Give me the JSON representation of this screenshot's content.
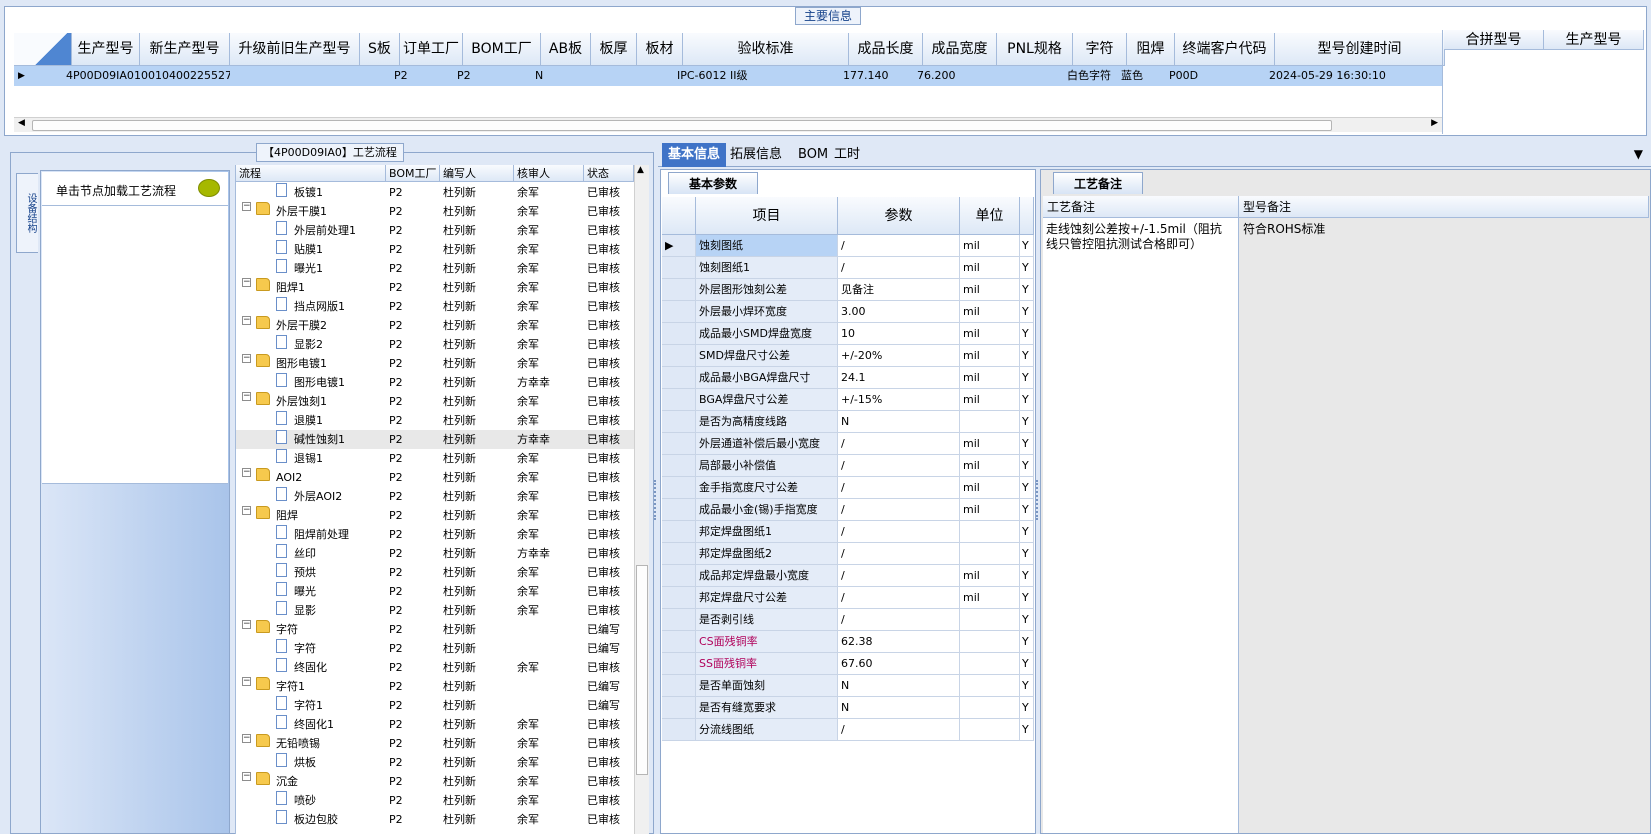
{
  "main": {
    "title": "主要信息",
    "columns": [
      "生产型号",
      "新生产型号",
      "升级前旧生产型号",
      "S板",
      "订单工厂",
      "BOM工厂",
      "AB板",
      "板厚",
      "板材",
      "验收标准",
      "成品长度",
      "成品宽度",
      "PNL规格",
      "字符",
      "阻焊",
      "终端客户代码",
      "型号创建时间"
    ],
    "row": [
      "4P00D09IA0",
      "10010400225527",
      "",
      "",
      "P2",
      "P2",
      "N",
      "",
      "",
      "IPC-6012 II级",
      "177.140",
      "76.200",
      "",
      "白色字符",
      "蓝色",
      "P00D",
      "2024-05-29 16:30:10"
    ],
    "side_columns": [
      "合拼型号",
      "生产型号"
    ]
  },
  "flow": {
    "title": "【4P00D09IA0】工艺流程",
    "side_tab": "设备结构",
    "hint": "单击节点加载工艺流程",
    "columns": [
      "流程",
      "BOM工厂",
      "编写人",
      "核审人",
      "状态"
    ],
    "rows": [
      {
        "name": "板镀1",
        "level": 2,
        "type": "doc",
        "bom": "P2",
        "writer": "杜列新",
        "reviewer": "余军",
        "status": "已审核"
      },
      {
        "name": "外层干膜1",
        "level": 1,
        "type": "folder",
        "bom": "P2",
        "writer": "杜列新",
        "reviewer": "余军",
        "status": "已审核"
      },
      {
        "name": "外层前处理1",
        "level": 2,
        "type": "doc",
        "bom": "P2",
        "writer": "杜列新",
        "reviewer": "余军",
        "status": "已审核"
      },
      {
        "name": "贴膜1",
        "level": 2,
        "type": "doc",
        "bom": "P2",
        "writer": "杜列新",
        "reviewer": "余军",
        "status": "已审核"
      },
      {
        "name": "曝光1",
        "level": 2,
        "type": "doc",
        "bom": "P2",
        "writer": "杜列新",
        "reviewer": "余军",
        "status": "已审核"
      },
      {
        "name": "阻焊1",
        "level": 1,
        "type": "folder",
        "bom": "P2",
        "writer": "杜列新",
        "reviewer": "余军",
        "status": "已审核"
      },
      {
        "name": "挡点网版1",
        "level": 2,
        "type": "doc",
        "bom": "P2",
        "writer": "杜列新",
        "reviewer": "余军",
        "status": "已审核"
      },
      {
        "name": "外层干膜2",
        "level": 1,
        "type": "folder",
        "bom": "P2",
        "writer": "杜列新",
        "reviewer": "余军",
        "status": "已审核"
      },
      {
        "name": "显影2",
        "level": 2,
        "type": "doc",
        "bom": "P2",
        "writer": "杜列新",
        "reviewer": "余军",
        "status": "已审核"
      },
      {
        "name": "图形电镀1",
        "level": 1,
        "type": "folder",
        "bom": "P2",
        "writer": "杜列新",
        "reviewer": "余军",
        "status": "已审核"
      },
      {
        "name": "图形电镀1",
        "level": 2,
        "type": "doc",
        "bom": "P2",
        "writer": "杜列新",
        "reviewer": "方幸幸",
        "status": "已审核"
      },
      {
        "name": "外层蚀刻1",
        "level": 1,
        "type": "folder",
        "bom": "P2",
        "writer": "杜列新",
        "reviewer": "余军",
        "status": "已审核"
      },
      {
        "name": "退膜1",
        "level": 2,
        "type": "doc",
        "bom": "P2",
        "writer": "杜列新",
        "reviewer": "余军",
        "status": "已审核"
      },
      {
        "name": "碱性蚀刻1",
        "level": 2,
        "type": "doc",
        "bom": "P2",
        "writer": "杜列新",
        "reviewer": "方幸幸",
        "status": "已审核",
        "selected": true
      },
      {
        "name": "退锡1",
        "level": 2,
        "type": "doc",
        "bom": "P2",
        "writer": "杜列新",
        "reviewer": "余军",
        "status": "已审核"
      },
      {
        "name": "AOI2",
        "level": 1,
        "type": "folder",
        "bom": "P2",
        "writer": "杜列新",
        "reviewer": "余军",
        "status": "已审核"
      },
      {
        "name": "外层AOI2",
        "level": 2,
        "type": "doc",
        "bom": "P2",
        "writer": "杜列新",
        "reviewer": "余军",
        "status": "已审核"
      },
      {
        "name": "阻焊",
        "level": 1,
        "type": "folder",
        "bom": "P2",
        "writer": "杜列新",
        "reviewer": "余军",
        "status": "已审核"
      },
      {
        "name": "阻焊前处理",
        "level": 2,
        "type": "doc",
        "bom": "P2",
        "writer": "杜列新",
        "reviewer": "余军",
        "status": "已审核"
      },
      {
        "name": "丝印",
        "level": 2,
        "type": "doc",
        "bom": "P2",
        "writer": "杜列新",
        "reviewer": "方幸幸",
        "status": "已审核"
      },
      {
        "name": "预烘",
        "level": 2,
        "type": "doc",
        "bom": "P2",
        "writer": "杜列新",
        "reviewer": "余军",
        "status": "已审核"
      },
      {
        "name": "曝光",
        "level": 2,
        "type": "doc",
        "bom": "P2",
        "writer": "杜列新",
        "reviewer": "余军",
        "status": "已审核"
      },
      {
        "name": "显影",
        "level": 2,
        "type": "doc",
        "bom": "P2",
        "writer": "杜列新",
        "reviewer": "余军",
        "status": "已审核"
      },
      {
        "name": "字符",
        "level": 1,
        "type": "folder",
        "bom": "P2",
        "writer": "杜列新",
        "reviewer": "",
        "status": "已编写"
      },
      {
        "name": "字符",
        "level": 2,
        "type": "doc",
        "bom": "P2",
        "writer": "杜列新",
        "reviewer": "",
        "status": "已编写"
      },
      {
        "name": "终固化",
        "level": 2,
        "type": "doc",
        "bom": "P2",
        "writer": "杜列新",
        "reviewer": "余军",
        "status": "已审核"
      },
      {
        "name": "字符1",
        "level": 1,
        "type": "folder",
        "bom": "P2",
        "writer": "杜列新",
        "reviewer": "",
        "status": "已编写"
      },
      {
        "name": "字符1",
        "level": 2,
        "type": "doc",
        "bom": "P2",
        "writer": "杜列新",
        "reviewer": "",
        "status": "已编写"
      },
      {
        "name": "终固化1",
        "level": 2,
        "type": "doc",
        "bom": "P2",
        "writer": "杜列新",
        "reviewer": "余军",
        "status": "已审核"
      },
      {
        "name": "无铅喷锡",
        "level": 1,
        "type": "folder",
        "bom": "P2",
        "writer": "杜列新",
        "reviewer": "余军",
        "status": "已审核"
      },
      {
        "name": "烘板",
        "level": 2,
        "type": "doc",
        "bom": "P2",
        "writer": "杜列新",
        "reviewer": "余军",
        "status": "已审核"
      },
      {
        "name": "沉金",
        "level": 1,
        "type": "folder",
        "bom": "P2",
        "writer": "杜列新",
        "reviewer": "余军",
        "status": "已审核"
      },
      {
        "name": "喷砂",
        "level": 2,
        "type": "doc",
        "bom": "P2",
        "writer": "杜列新",
        "reviewer": "余军",
        "status": "已审核"
      },
      {
        "name": "板边包胶",
        "level": 2,
        "type": "doc",
        "bom": "P2",
        "writer": "杜列新",
        "reviewer": "余军",
        "status": "已审核"
      }
    ]
  },
  "tabs": [
    "基本信息",
    "拓展信息",
    "BOM",
    "工时"
  ],
  "basic": {
    "subtab": "基本参数",
    "columns": [
      "项目",
      "参数",
      "单位"
    ],
    "rows": [
      {
        "item": "蚀刻图纸",
        "value": "/",
        "unit": "mil",
        "flag": "Y"
      },
      {
        "item": "蚀刻图纸1",
        "value": "/",
        "unit": "mil",
        "flag": "Y"
      },
      {
        "item": "外层图形蚀刻公差",
        "value": "见备注",
        "unit": "mil",
        "flag": "Y"
      },
      {
        "item": "外层最小焊环宽度",
        "value": "3.00",
        "unit": "mil",
        "flag": "Y"
      },
      {
        "item": "成品最小SMD焊盘宽度",
        "value": "10",
        "unit": "mil",
        "flag": "Y"
      },
      {
        "item": "SMD焊盘尺寸公差",
        "value": "+/-20%",
        "unit": "mil",
        "flag": "Y"
      },
      {
        "item": "成品最小BGA焊盘尺寸",
        "value": "24.1",
        "unit": "mil",
        "flag": "Y"
      },
      {
        "item": "BGA焊盘尺寸公差",
        "value": "+/-15%",
        "unit": "mil",
        "flag": "Y"
      },
      {
        "item": "是否为高精度线路",
        "value": "N",
        "unit": "",
        "flag": "Y"
      },
      {
        "item": "外层通道补偿后最小宽度",
        "value": "/",
        "unit": "mil",
        "flag": "Y"
      },
      {
        "item": "局部最小补偿值",
        "value": "/",
        "unit": "mil",
        "flag": "Y"
      },
      {
        "item": "金手指宽度尺寸公差",
        "value": "/",
        "unit": "mil",
        "flag": "Y"
      },
      {
        "item": "成品最小金(锡)手指宽度",
        "value": "/",
        "unit": "mil",
        "flag": "Y"
      },
      {
        "item": "邦定焊盘图纸1",
        "value": "/",
        "unit": "",
        "flag": "Y"
      },
      {
        "item": "邦定焊盘图纸2",
        "value": "/",
        "unit": "",
        "flag": "Y"
      },
      {
        "item": "成品邦定焊盘最小宽度",
        "value": "/",
        "unit": "mil",
        "flag": "Y"
      },
      {
        "item": "邦定焊盘尺寸公差",
        "value": "/",
        "unit": "mil",
        "flag": "Y"
      },
      {
        "item": "是否剥引线",
        "value": "/",
        "unit": "",
        "flag": "Y"
      },
      {
        "item": "CS面残铜率",
        "value": "62.38",
        "unit": "",
        "flag": "Y",
        "magenta": true
      },
      {
        "item": "SS面残铜率",
        "value": "67.60",
        "unit": "",
        "flag": "Y",
        "magenta": true
      },
      {
        "item": "是否单面蚀刻",
        "value": "N",
        "unit": "",
        "flag": "Y"
      },
      {
        "item": "是否有缝宽要求",
        "value": "N",
        "unit": "",
        "flag": "Y"
      },
      {
        "item": "分流线图纸",
        "value": "/",
        "unit": "",
        "flag": "Y"
      }
    ]
  },
  "remarks": {
    "subtab": "工艺备注",
    "process_label": "工艺备注",
    "model_label": "型号备注",
    "process_text": "走线蚀刻公差按+/-1.5mil（阻抗线只管控阻抗测试合格即可）",
    "model_text": "符合ROHS标准"
  }
}
